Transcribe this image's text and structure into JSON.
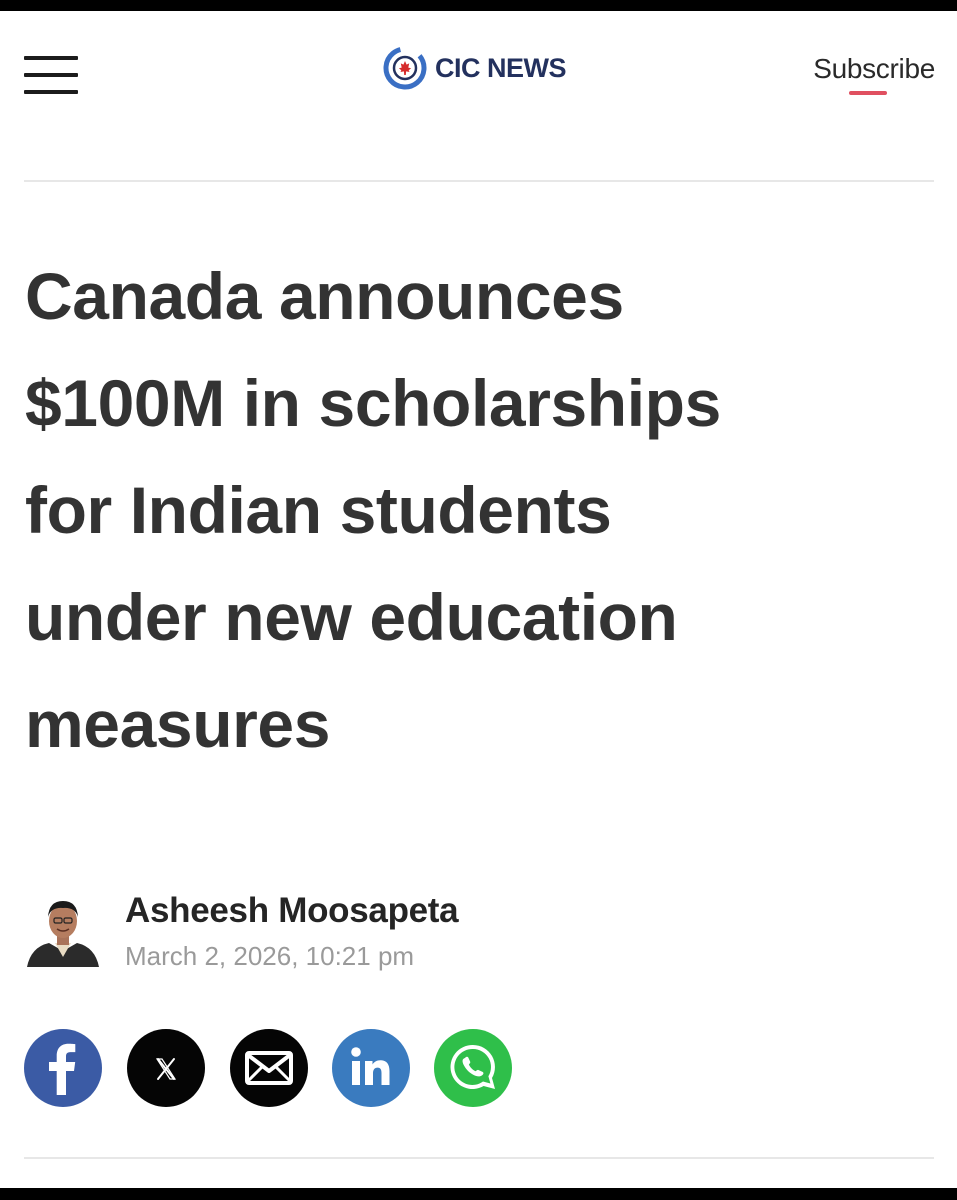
{
  "header": {
    "brand_name": "CIC NEWS",
    "subscribe_label": "Subscribe"
  },
  "article": {
    "headline_lines": [
      "Canada announces",
      "$100M in scholarships",
      "for Indian students",
      "under new education",
      "measures"
    ],
    "author_name": "Asheesh Moosapeta",
    "published": "March 2, 2026, 10:21 pm"
  },
  "share": {
    "icons": [
      "facebook-icon",
      "x-icon",
      "email-icon",
      "linkedin-icon",
      "whatsapp-icon"
    ],
    "x_glyph": "𝕏"
  },
  "colors": {
    "brand_navy": "#23315e",
    "brand_blue": "#3a6fc4",
    "maple_red": "#d62b2b",
    "subscribe_underline": "#e05060",
    "facebook": "#3b5ba5",
    "linkedin": "#3a7bbf",
    "whatsapp": "#2fbf4a"
  }
}
